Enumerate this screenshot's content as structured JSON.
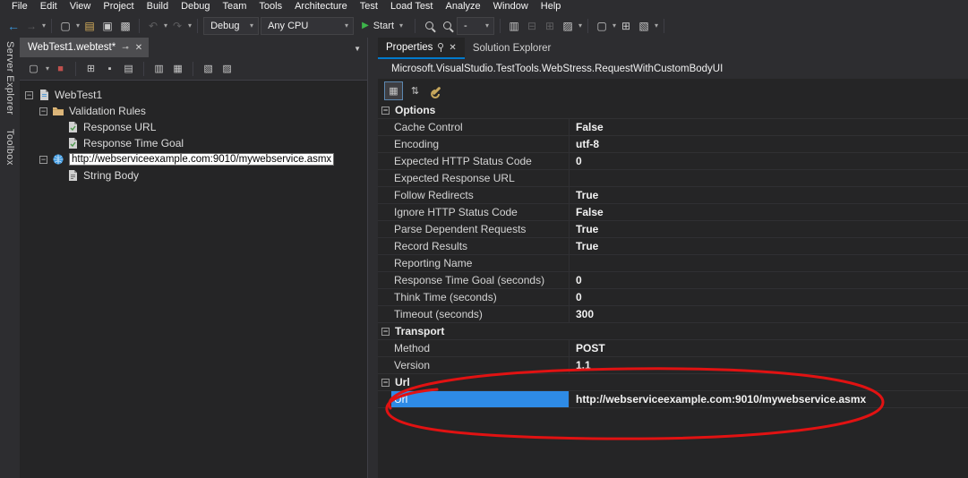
{
  "menu": {
    "items": [
      "File",
      "Edit",
      "View",
      "Project",
      "Build",
      "Debug",
      "Team",
      "Tools",
      "Architecture",
      "Test",
      "Load Test",
      "Analyze",
      "Window",
      "Help"
    ]
  },
  "toolbar": {
    "configuration": "Debug",
    "platform": "Any CPU",
    "start_label": "Start",
    "zoom_value": "-"
  },
  "side_tabs": [
    "Server Explorer",
    "Toolbox"
  ],
  "editor": {
    "tab_label": "WebTest1.webtest*",
    "toolbar_icons": [
      "add-request-icon",
      "record-icon",
      "add-data-source-icon",
      "set-credentials-icon",
      "generate-code-icon",
      "parameterize-web-servers-icon",
      "add-plugin-icon",
      "performance-icon",
      "run-test-icon"
    ],
    "tree": [
      {
        "label": "WebTest1",
        "level": 0,
        "icon": "webtest-icon",
        "expander": true,
        "selected": false
      },
      {
        "label": "Validation Rules",
        "level": 1,
        "icon": "folder-icon",
        "expander": true,
        "selected": false
      },
      {
        "label": "Response URL",
        "level": 2,
        "icon": "validation-rule-icon",
        "expander": false,
        "selected": false
      },
      {
        "label": "Response Time Goal",
        "level": 2,
        "icon": "validation-rule-icon",
        "expander": false,
        "selected": false
      },
      {
        "label": "http://webserviceexample.com:9010/mywebservice.asmx",
        "level": 1,
        "icon": "request-icon",
        "expander": true,
        "selected": true
      },
      {
        "label": "String Body",
        "level": 2,
        "icon": "string-body-icon",
        "expander": false,
        "selected": false
      }
    ]
  },
  "properties": {
    "tabs": [
      {
        "label": "Properties",
        "active": true
      },
      {
        "label": "Solution Explorer",
        "active": false
      }
    ],
    "object_name": "Microsoft.VisualStudio.TestTools.WebStress.RequestWithCustomBodyUI",
    "groups": [
      {
        "name": "Options",
        "rows": [
          {
            "label": "Cache Control",
            "value": "False",
            "selected": false
          },
          {
            "label": "Encoding",
            "value": "utf-8",
            "selected": false
          },
          {
            "label": "Expected HTTP Status Code",
            "value": "0",
            "selected": false
          },
          {
            "label": "Expected Response URL",
            "value": "",
            "selected": false
          },
          {
            "label": "Follow Redirects",
            "value": "True",
            "selected": false
          },
          {
            "label": "Ignore HTTP Status Code",
            "value": "False",
            "selected": false
          },
          {
            "label": "Parse Dependent Requests",
            "value": "True",
            "selected": false
          },
          {
            "label": "Record Results",
            "value": "True",
            "selected": false
          },
          {
            "label": "Reporting Name",
            "value": "",
            "selected": false
          },
          {
            "label": "Response Time Goal (seconds)",
            "value": "0",
            "selected": false
          },
          {
            "label": "Think Time (seconds)",
            "value": "0",
            "selected": false
          },
          {
            "label": "Timeout (seconds)",
            "value": "300",
            "selected": false
          }
        ]
      },
      {
        "name": "Transport",
        "rows": [
          {
            "label": "Method",
            "value": "POST",
            "selected": false
          },
          {
            "label": "Version",
            "value": "1.1",
            "selected": false
          }
        ]
      },
      {
        "name": "Url",
        "rows": [
          {
            "label": "Url",
            "value": "http://webserviceexample.com:9010/mywebservice.asmx",
            "selected": true
          }
        ]
      }
    ]
  },
  "colors": {
    "accent": "#007acc",
    "selection_blue": "#2e8be6",
    "annotation_red": "#e11212",
    "start_green": "#3db54a"
  }
}
